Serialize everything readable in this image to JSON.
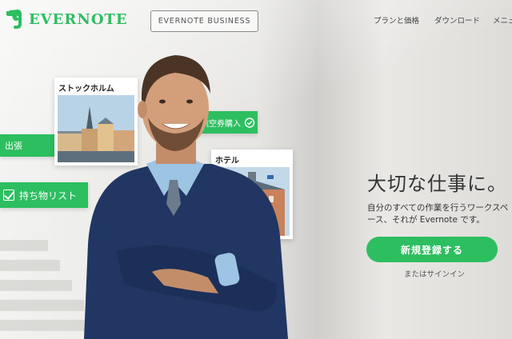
{
  "brand": {
    "name": "EVERNOTE",
    "color": "#2dbe60"
  },
  "header": {
    "business_button": "EVERNOTE BUSINESS",
    "nav": [
      "プランと価格",
      "ダウンロード",
      "メニュー"
    ]
  },
  "cards": [
    {
      "title": "ストックホルム"
    },
    {
      "title": "ホテル"
    }
  ],
  "tags": {
    "flight": "航空券購入",
    "trip": "出張",
    "packing": "持ち物リスト"
  },
  "hero": {
    "headline": "大切な仕事に。",
    "subtext": "自分のすべての作業を行うワークスペース、それが Evernote です。",
    "signup_button": "新規登録する",
    "signin_link": "またはサインイン"
  }
}
